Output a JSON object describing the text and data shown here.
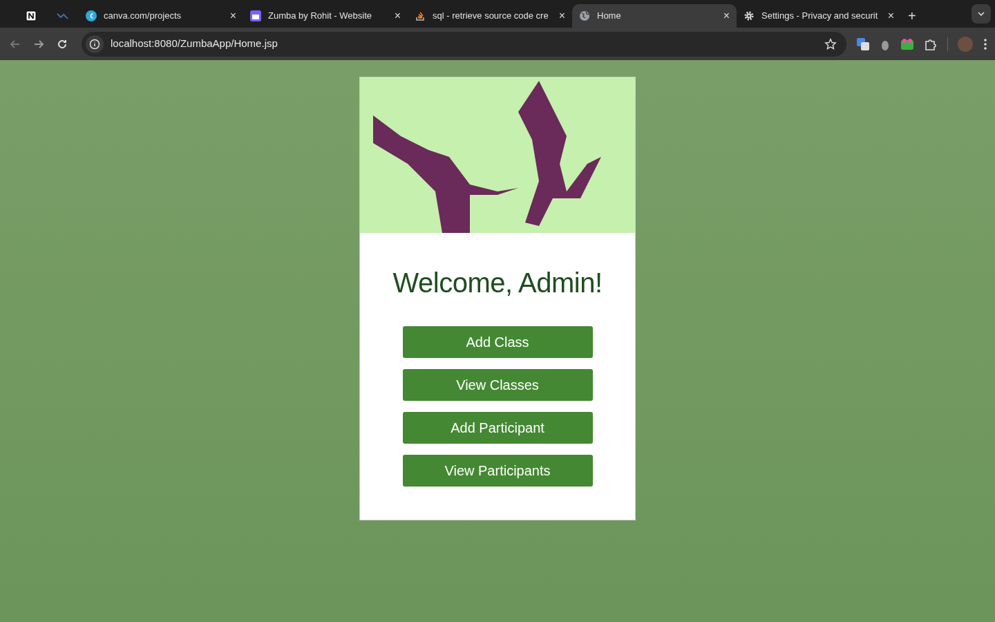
{
  "browser": {
    "tabs": [
      {
        "kind": "pinned",
        "selected": false
      },
      {
        "kind": "pinned",
        "selected": false
      },
      {
        "kind": "tab",
        "title": "canva.com/projects",
        "close": "×",
        "selected": false
      },
      {
        "kind": "tab",
        "title": "Zumba by Rohit - Website",
        "close": "×",
        "selected": false
      },
      {
        "kind": "tab",
        "title": "sql - retrieve source code cre",
        "close": "×",
        "selected": false
      },
      {
        "kind": "tab",
        "title": "Home",
        "close": "×",
        "selected": true
      },
      {
        "kind": "tab",
        "title": "Settings - Privacy and securit",
        "close": "×",
        "selected": false
      }
    ],
    "new_tab": "+",
    "url": "localhost:8080/ZumbaApp/Home.jsp"
  },
  "page": {
    "heading": "Welcome, Admin!",
    "buttons": [
      "Add Class",
      "View Classes",
      "Add Participant",
      "View Participants"
    ]
  }
}
